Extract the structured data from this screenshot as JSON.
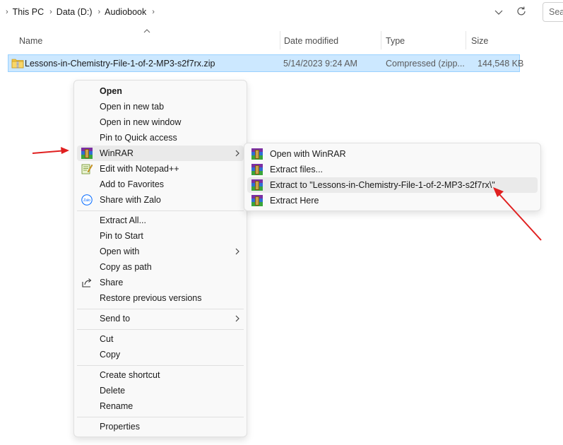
{
  "address": {
    "breadcrumbs": [
      "This PC",
      "Data (D:)",
      "Audiobook"
    ],
    "search_placeholder": "Search"
  },
  "columns": {
    "name": "Name",
    "date": "Date modified",
    "type": "Type",
    "size": "Size"
  },
  "file": {
    "name": "Lessons-in-Chemistry-File-1-of-2-MP3-s2f7rx.zip",
    "date": "5/14/2023 9:24 AM",
    "type": "Compressed (zipp...",
    "size": "144,548 KB"
  },
  "context_menu": {
    "open": "Open",
    "open_new_tab": "Open in new tab",
    "open_new_window": "Open in new window",
    "pin_quick_access": "Pin to Quick access",
    "winrar": "WinRAR",
    "edit_notepad": "Edit with Notepad++",
    "add_favorites": "Add to Favorites",
    "share_zalo": "Share with Zalo",
    "extract_all": "Extract All...",
    "pin_start": "Pin to Start",
    "open_with": "Open with",
    "copy_path": "Copy as path",
    "share": "Share",
    "restore_versions": "Restore previous versions",
    "send_to": "Send to",
    "cut": "Cut",
    "copy": "Copy",
    "create_shortcut": "Create shortcut",
    "delete": "Delete",
    "rename": "Rename",
    "properties": "Properties",
    "zalo_icon_text": "Zalo"
  },
  "winrar_submenu": {
    "open_with_winrar": "Open with WinRAR",
    "extract_files": "Extract files...",
    "extract_to": "Extract to \"Lessons-in-Chemistry-File-1-of-2-MP3-s2f7rx\\\"",
    "extract_here": "Extract Here"
  },
  "colors": {
    "selection_bg": "#cce8ff",
    "selection_border": "#99d1ff",
    "annotation_arrow": "#e02020",
    "menu_bg": "#f9f9f9"
  },
  "icons": {
    "winrar": "winrar-icon",
    "notepad": "notepad-plus-plus-icon",
    "zalo": "zalo-icon",
    "share": "share-icon",
    "zip": "zip-folder-icon"
  }
}
